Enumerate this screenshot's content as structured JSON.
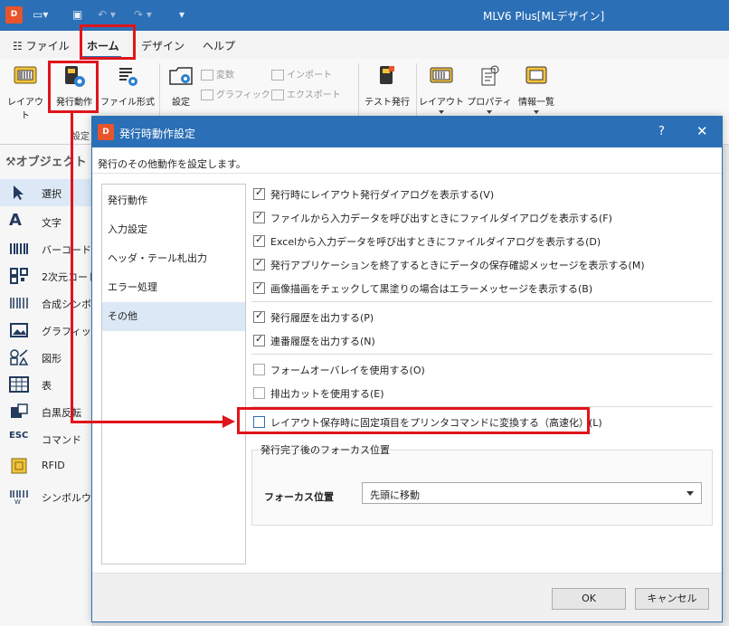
{
  "titlebar": {
    "logo": "D",
    "title": "MLV6 Plus[MLデザイン]",
    "qa_icons": [
      "open-folder-icon",
      "save-icon",
      "undo-icon",
      "redo-icon",
      "customize-icon"
    ]
  },
  "ribbon_tabs": [
    {
      "label": "ファイル",
      "icon": "menu-list-icon"
    },
    {
      "label": "ホーム",
      "active": true
    },
    {
      "label": "デザイン"
    },
    {
      "label": "ヘルプ"
    }
  ],
  "ribbon": {
    "layout": "レイアウト",
    "issue_action": "発行動作",
    "file_format": "ファイル形式",
    "settings": "設定",
    "group_label": "設定",
    "variable": "変数",
    "graphic": "グラフィック",
    "import": "インポート",
    "export": "エクスポート",
    "test_issue": "テスト発行",
    "layout2": "レイアウト",
    "properties": "プロパティ",
    "info_list": "情報一覧"
  },
  "object_panel": {
    "title": "オブジェクト",
    "items": [
      {
        "label": "選択",
        "icon": "cursor-arrow-icon"
      },
      {
        "label": "文字",
        "icon": "text-a-icon"
      },
      {
        "label": "バーコード",
        "icon": "barcode-icon"
      },
      {
        "label": "2次元コード",
        "icon": "qr-code-icon"
      },
      {
        "label": "合成シンボル",
        "icon": "composite-symbol-icon"
      },
      {
        "label": "グラフィック",
        "icon": "image-icon"
      },
      {
        "label": "図形",
        "icon": "shapes-icon"
      },
      {
        "label": "表",
        "icon": "table-icon"
      },
      {
        "label": "白黒反転",
        "icon": "invert-icon"
      },
      {
        "label": "コマンド",
        "icon": "esc-command-icon"
      },
      {
        "label": "RFID",
        "icon": "rfid-icon"
      },
      {
        "label": "シンボルウィ",
        "icon": "symbol-wizard-icon"
      }
    ]
  },
  "dialog": {
    "logo": "D",
    "title": "発行時動作設定",
    "help": "?",
    "close": "✕",
    "description": "発行のその他動作を設定します。",
    "nav": [
      "発行動作",
      "入力設定",
      "ヘッダ・テール札出力",
      "エラー処理",
      "その他"
    ],
    "options": [
      {
        "label": "発行時にレイアウト発行ダイアログを表示する(V)",
        "checked": true
      },
      {
        "label": "ファイルから入力データを呼び出すときにファイルダイアログを表示する(F)",
        "checked": true
      },
      {
        "label": "Excelから入力データを呼び出すときにファイルダイアログを表示する(D)",
        "checked": true
      },
      {
        "label": "発行アプリケーションを終了するときにデータの保存確認メッセージを表示する(M)",
        "checked": true
      },
      {
        "label": "画像描画をチェックして黒塗りの場合はエラーメッセージを表示する(B)",
        "checked": true
      },
      {
        "label": "発行履歴を出力する(P)",
        "checked": true
      },
      {
        "label": "連番履歴を出力する(N)",
        "checked": true
      },
      {
        "label": "フォームオーバレイを使用する(O)",
        "checked": false
      },
      {
        "label": "排出カットを使用する(E)",
        "checked": false
      },
      {
        "label": "レイアウト保存時に固定項目をプリンタコマンドに変換する（高速化）(L)",
        "checked": false
      }
    ],
    "focus_group": {
      "title": "発行完了後のフォーカス位置",
      "label": "フォーカス位置",
      "value": "先頭に移動"
    },
    "ok": "OK",
    "cancel": "キャンセル"
  },
  "colors": {
    "title_blue": "#2b6fb6",
    "highlight_red": "#e0141b",
    "selection_bg": "#dce8f5",
    "logo_orange": "#e8542b"
  }
}
